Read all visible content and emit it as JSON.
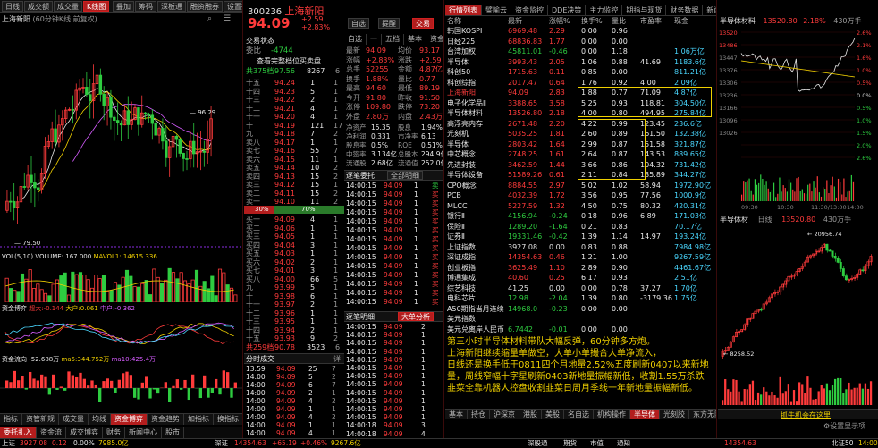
{
  "colors": {
    "up": "#ff3b3b",
    "down": "#2ecc40",
    "accent": "#f0d000",
    "cyan": "#4ad7ff",
    "purple": "#d65cff",
    "bg": "#000000"
  },
  "left": {
    "toolbar": [
      "日线",
      "成交额",
      "成交量",
      "K线图",
      "叠加",
      "筹码",
      "深板通",
      "融资融券",
      "设置指标"
    ],
    "header": {
      "name": "上海新阳",
      "suffix": "(60分钟K线 前复权)"
    },
    "icons": [
      "search-icon",
      "list-icon"
    ],
    "price_labels": {
      "high": "96.29",
      "low": "79.50"
    },
    "vol_header": {
      "name": "VOL(5,10)",
      "vol": "VOLUME: 167.000",
      "ma5": "MAVOL1: 14615.336",
      "buttons": [
        "加指标",
        "加指标",
        "换指标"
      ]
    },
    "fund_header": {
      "name": "资金博弈",
      "big": "超大:-0.144",
      "mid": "大户:0.061",
      "small": "中户:-0.362",
      "retail": "散户数据",
      "buttons": [
        "加指标",
        "换指标"
      ]
    },
    "flow_header": {
      "name": "资金流向",
      "amt": "-52.688万",
      "ma5": "ma5:344.752万",
      "ma10": "ma10:425.4万",
      "buttons": [
        "加指标",
        "换指标"
      ]
    },
    "bottom_tabs": [
      "指标",
      "资管新规",
      "成交量",
      "均线",
      "资金博弈",
      "资金趋势",
      "加指标",
      "换指标"
    ],
    "footer": [
      "委托扎入",
      "资金流",
      "成交博弈",
      "财务",
      "新闻中心",
      "股市"
    ]
  },
  "middle": {
    "code": "300236",
    "name": "上海新阳",
    "price": "94.09",
    "change": "+2.59",
    "pct": "+2.83%",
    "buttons": {
      "self": "自选",
      "alert": "提醒",
      "trade": "交易",
      "quick": "快捷"
    },
    "tabs": [
      "自选",
      "一",
      "五档",
      "基本",
      "资金",
      "明细"
    ],
    "stats_title": "交易状态",
    "stat1": [
      {
        "k": "委比",
        "v": "-40.24%",
        "k2": "委差",
        "v2": "-4744"
      }
    ],
    "orderbook_link": "查看完整档位买卖盘",
    "total_ask": {
      "label": "共375档",
      "price": "97.56",
      "vol": "8267",
      "n": "6"
    },
    "asks": [
      {
        "l": "十五",
        "p": "94.24",
        "v": "1",
        "n": "1"
      },
      {
        "l": "十四",
        "p": "94.23",
        "v": "5",
        "n": "1"
      },
      {
        "l": "十三",
        "p": "94.22",
        "v": "2",
        "n": "1"
      },
      {
        "l": "十二",
        "p": "94.21",
        "v": "4",
        "n": "1"
      },
      {
        "l": "十一",
        "p": "94.20",
        "v": "4",
        "n": "1"
      },
      {
        "l": "十",
        "p": "94.19",
        "v": "121",
        "n": "17"
      },
      {
        "l": "九",
        "p": "94.18",
        "v": "7",
        "n": "2"
      },
      {
        "l": "卖八",
        "p": "94.17",
        "v": "1",
        "n": "1"
      },
      {
        "l": "卖七",
        "p": "94.16",
        "v": "55",
        "n": "7"
      },
      {
        "l": "卖六",
        "p": "94.15",
        "v": "11",
        "n": "1"
      },
      {
        "l": "卖五",
        "p": "94.14",
        "v": "10",
        "n": "2"
      },
      {
        "l": "卖四",
        "p": "94.13",
        "v": "15",
        "n": "2"
      },
      {
        "l": "卖三",
        "p": "94.12",
        "v": "15",
        "n": "1"
      },
      {
        "l": "卖二",
        "p": "94.11",
        "v": "15",
        "n": "2"
      },
      {
        "l": "卖一",
        "p": "94.10",
        "v": "11",
        "n": "2"
      }
    ],
    "ratio": {
      "buy": "30%",
      "sell": "70%"
    },
    "bids": [
      {
        "l": "买一",
        "p": "94.09",
        "v": "4",
        "n": "1"
      },
      {
        "l": "买二",
        "p": "94.06",
        "v": "1",
        "n": "1"
      },
      {
        "l": "买三",
        "p": "94.05",
        "v": "1",
        "n": "1"
      },
      {
        "l": "买四",
        "p": "94.04",
        "v": "3",
        "n": "1"
      },
      {
        "l": "买五",
        "p": "94.03",
        "v": "1",
        "n": "1"
      },
      {
        "l": "买六",
        "p": "94.02",
        "v": "2",
        "n": "1"
      },
      {
        "l": "买七",
        "p": "94.01",
        "v": "3",
        "n": "1"
      },
      {
        "l": "买八",
        "p": "94.00",
        "v": "66",
        "n": "5"
      },
      {
        "l": "九",
        "p": "93.99",
        "v": "5",
        "n": "1"
      },
      {
        "l": "十",
        "p": "93.98",
        "v": "6",
        "n": "1"
      },
      {
        "l": "十一",
        "p": "93.97",
        "v": "2",
        "n": "1"
      },
      {
        "l": "十二",
        "p": "93.96",
        "v": "1",
        "n": "1"
      },
      {
        "l": "十三",
        "p": "93.95",
        "v": "1",
        "n": "1"
      },
      {
        "l": "十四",
        "p": "93.94",
        "v": "2",
        "n": "1"
      },
      {
        "l": "十五",
        "p": "93.93",
        "v": "9",
        "n": "2"
      }
    ],
    "total_bid": {
      "label": "共259档",
      "price": "90.78",
      "vol": "3523",
      "n": "6"
    },
    "quote": [
      [
        "最新",
        "94.09",
        "均价",
        "93.17"
      ],
      [
        "涨幅",
        "+2.83%",
        "涨跌",
        "+2.59"
      ],
      [
        "总手",
        "52255",
        "金额",
        "4.87亿"
      ],
      [
        "换手",
        "1.88%",
        "量比",
        "0.77"
      ],
      [
        "最高",
        "94.60",
        "最低",
        "89.19"
      ],
      [
        "今开",
        "91.80",
        "昨收",
        "91.50"
      ],
      [
        "涨停",
        "109.80",
        "跌停",
        "73.20"
      ],
      [
        "外盘",
        "2.80万",
        "内盘",
        "2.43万"
      ]
    ],
    "fundamentals": [
      [
        "净资产",
        "15.35",
        "股息",
        "1.94%"
      ],
      [
        "净利润",
        "0.331",
        "市净率",
        "6.13"
      ],
      [
        "股息率",
        "0.5%",
        "ROE",
        "0.51%"
      ],
      [
        "中签率",
        "3.134亿",
        "总股本",
        "294.9亿"
      ],
      [
        "流通股",
        "2.68亿",
        "流通值",
        "252.0亿"
      ]
    ],
    "ticks_header": {
      "title": "逐笔委托",
      "filter": "全部明细"
    },
    "ticks": [
      [
        "14:00:15",
        "94.09",
        "1",
        "卖"
      ],
      [
        "14:00:15",
        "94.09",
        "1",
        "买"
      ],
      [
        "14:00:15",
        "94.09",
        "1",
        "买"
      ],
      [
        "14:00:15",
        "94.09",
        "1",
        "买"
      ],
      [
        "14:00:15",
        "94.09",
        "1",
        "买"
      ],
      [
        "14:00:15",
        "94.09",
        "1",
        "买"
      ],
      [
        "14:00:15",
        "94.09",
        "1",
        "买"
      ],
      [
        "14:00:15",
        "94.09",
        "1",
        "买"
      ],
      [
        "14:00:15",
        "94.09",
        "1",
        "买"
      ],
      [
        "14:00:15",
        "94.09",
        "1",
        "买"
      ],
      [
        "14:00:15",
        "94.09",
        "1",
        "买"
      ],
      [
        "14:00:15",
        "94.09",
        "1",
        "买"
      ],
      [
        "14:00:15",
        "94.09",
        "1",
        "买"
      ],
      [
        "14:00:15",
        "94.09",
        "1",
        "买"
      ],
      [
        "14:00:15",
        "94.09",
        "1",
        "买"
      ],
      [
        "14:00:18",
        "94.09",
        "1",
        "买"
      ],
      [
        "14:00:18",
        "94.09",
        "1",
        "买"
      ],
      [
        "14:00:18",
        "94.09",
        "1",
        "买"
      ],
      [
        "14:00:18",
        "94.09",
        "1",
        "买"
      ],
      [
        "14:00:18",
        "94.09",
        "1",
        "买"
      ]
    ],
    "fill_header": {
      "title": "逐笔明细",
      "filter": "大单分析"
    },
    "fills": [
      [
        "14:00:15",
        "94.09",
        "2"
      ],
      [
        "14:00:15",
        "94.09",
        "1"
      ],
      [
        "14:00:15",
        "94.09",
        "1"
      ],
      [
        "14:00:15",
        "94.09",
        "1"
      ],
      [
        "14:00:15",
        "94.09",
        "1"
      ],
      [
        "14:00:15",
        "94.09",
        "1"
      ],
      [
        "14:00:15",
        "94.09",
        "1"
      ],
      [
        "14:00:15",
        "94.09",
        "1"
      ],
      [
        "14:00:15",
        "94.09",
        "1"
      ],
      [
        "14:00:15",
        "94.09",
        "1"
      ],
      [
        "14:00:15",
        "94.09",
        "1"
      ],
      [
        "14:00:15",
        "94.09",
        "1"
      ],
      [
        "14:00:18",
        "94.09",
        "3"
      ],
      [
        "14:00:18",
        "94.09",
        "4"
      ]
    ],
    "minute_header": {
      "title": "分时成交",
      "expand": "详"
    },
    "minutes": [
      [
        "13:59",
        "94.09",
        "25",
        "7"
      ],
      [
        "14:00",
        "94.09",
        "5",
        "2"
      ],
      [
        "14:00",
        "94.09",
        "6",
        "7"
      ],
      [
        "14:00",
        "94.09",
        "2",
        "1"
      ],
      [
        "14:00",
        "94.09",
        "4",
        "2"
      ],
      [
        "14:00",
        "94.09",
        "1",
        "1"
      ],
      [
        "14:00",
        "94.09",
        "4",
        "2"
      ],
      [
        "14:00",
        "94.09",
        "1",
        "1"
      ],
      [
        "14:00",
        "94.09",
        "4",
        "1"
      ]
    ]
  },
  "table": {
    "tabs": [
      "行情列表",
      "譬喻云",
      "资金监控",
      "DDE决策",
      "主力监控",
      "期指与现货",
      "财务数据",
      "新闻资讯",
      "多窗同列"
    ],
    "headers": [
      "名称",
      "最新",
      "涨幅%",
      "换手%",
      "量比",
      "市盈率",
      "现金"
    ],
    "rows": [
      [
        "韩国KOSPI",
        "6969.48",
        "2.29",
        "0.00",
        "0.96",
        "",
        ""
      ],
      [
        "日经225",
        "68836.83",
        "1.77",
        "0.00",
        "0.00",
        "",
        ""
      ],
      [
        "台湾加权",
        "45811.01",
        "-0.46",
        "0.00",
        "1.18",
        "",
        "1.06万亿"
      ],
      [
        "半导体",
        "3993.43",
        "2.05",
        "1.06",
        "0.88",
        "41.69",
        "1183.6亿"
      ],
      [
        "科创50",
        "1715.63",
        "0.11",
        "0.85",
        "0.00",
        "",
        "811.21亿"
      ],
      [
        "科创综指",
        "2017.47",
        "0.64",
        "1.76",
        "0.92",
        "4.00",
        "2.09亿"
      ],
      [
        "上海新阳",
        "94.09",
        "2.83",
        "1.88",
        "0.77",
        "71.09",
        "4.87亿"
      ],
      [
        "电子化学品Ⅱ",
        "3388.65",
        "3.58",
        "5.25",
        "0.93",
        "118.81",
        "304.50亿"
      ],
      [
        "半导体材料",
        "13526.80",
        "2.18",
        "4.00",
        "0.80",
        "494.95",
        "275.84亿"
      ],
      [
        "高浮亮内存",
        "2671.48",
        "2.20",
        "4.22",
        "0.99",
        "123.45",
        "236.6亿"
      ],
      [
        "光刻机",
        "5035.25",
        "1.81",
        "2.60",
        "0.89",
        "161.50",
        "132.38亿"
      ],
      [
        "半导体",
        "2803.42",
        "1.64",
        "2.99",
        "0.87",
        "151.58",
        "321.87亿"
      ],
      [
        "中芯概念",
        "2748.25",
        "1.61",
        "2.64",
        "0.87",
        "143.53",
        "889.65亿"
      ],
      [
        "先进封装",
        "3462.59",
        "1.44",
        "3.66",
        "0.86",
        "104.32",
        "731.42亿"
      ],
      [
        "半导体设备",
        "51589.26",
        "0.61",
        "2.11",
        "0.84",
        "135.89",
        "344.27亿"
      ],
      [
        "CPO概念",
        "8884.55",
        "2.97",
        "5.02",
        "1.02",
        "58.94",
        "1972.90亿"
      ],
      [
        "PCB",
        "4032.39",
        "1.72",
        "3.56",
        "0.95",
        "77.56",
        "1000.9亿"
      ],
      [
        "MLCC",
        "5227.59",
        "1.32",
        "4.50",
        "0.75",
        "80.32",
        "420.31亿"
      ],
      [
        "银行Ⅱ",
        "4156.94",
        "-0.24",
        "0.18",
        "0.96",
        "6.89",
        "171.03亿"
      ],
      [
        "保险Ⅱ",
        "1289.20",
        "-1.64",
        "0.21",
        "0.83",
        "",
        "70.17亿"
      ],
      [
        "证券Ⅱ",
        "19331.46",
        "-0.42",
        "1.39",
        "1.14",
        "14.97",
        "193.24亿"
      ],
      [
        "上证指数",
        "3927.08",
        "0.00",
        "0.83",
        "0.88",
        "",
        "7984.98亿"
      ],
      [
        "深证成指",
        "14354.63",
        "0.46",
        "1.21",
        "1.00",
        "",
        "9267.59亿"
      ],
      [
        "创业板指",
        "3625.49",
        "1.10",
        "2.89",
        "0.90",
        "",
        "4461.67亿"
      ],
      [
        "博通集成",
        "40.60",
        "0.25",
        "6.17",
        "0.93",
        "",
        "2.51亿"
      ],
      [
        "综艺科技",
        "41.25",
        "0.00",
        "0.00",
        "0.78",
        "37.27",
        "1.70亿"
      ],
      [
        "电科芯片",
        "12.98",
        "-2.04",
        "1.39",
        "0.80",
        "-3179.36",
        "1.75亿"
      ],
      [
        "A50期指当月连续",
        "14968.0",
        "-0.23",
        "0.00",
        "0.00",
        "",
        ""
      ],
      [
        "美元指数",
        "",
        "",
        "",
        "",
        "",
        ""
      ],
      [
        "美元兑离岸人民币",
        "6.7442",
        "-0.01",
        "0.00",
        "0.00",
        "",
        ""
      ]
    ],
    "news": [
      "第三小时半导体材料带队大幅反弹，60分钟多方炮。",
      "上海新阳继续缩量单做空，大单小单撮合大单净流入，",
      "日线还是换手低于0811四个月地量2.52%五度刷新0407以来新地",
      "量，周线窄幅十字星刷新0403新地量振幅新低，收割1.55万杀跌",
      "韭菜全靠机器人控盘收割韭菜日周月季线一年新地量振幅新低。"
    ],
    "bottom_tabs": [
      "基本",
      "持仓",
      "沪深京",
      "港股",
      "美股",
      "名自选",
      "机构操作",
      "半导体",
      "光刻胶",
      "东方无限量",
      "债券",
      "更多"
    ],
    "bottom_active": "半导体"
  },
  "right": {
    "top": {
      "title": "半导体材料",
      "price": "13520.80",
      "pct": "2.18%",
      "vol": "430万手",
      "y_labels_right": [
        "2.6%",
        "2.1%",
        "1.6%",
        "1.0%",
        "0.5%",
        "0.0%",
        "0.5%",
        "1.0%",
        "1.5%",
        "2.0%",
        "2.6%"
      ],
      "y_labels_left": [
        "13520",
        "13486",
        "13447",
        "13376",
        "13306",
        "13236",
        "13166",
        "13096",
        "13026"
      ],
      "x_labels": [
        "09:30",
        "10:30",
        "11:30/13:00",
        "14:00"
      ]
    },
    "bottom": {
      "title": "半导体材",
      "period": "日线",
      "price": "13520.80",
      "vol": "430万手",
      "high_label": "20956.74",
      "low_label": "8258.52"
    },
    "ticker": "抓牛机会在这里",
    "settings": "设置显示项"
  },
  "footer": {
    "items": [
      {
        "name": "上证",
        "value": "3927.08",
        "chg": "0.12",
        "pct": "0.00%",
        "amt": "7985.0亿"
      },
      {
        "name": "深证",
        "value": "14354.63",
        "chg": "+65.19",
        "pct": "+0.46%",
        "amt": "9267.6亿"
      },
      {
        "name": "北证50",
        "value": "1413",
        "chg": "",
        "pct": "",
        "amt": ""
      }
    ],
    "status": [
      "深股通",
      "期货",
      "市值",
      "通知"
    ],
    "clock": "14:00"
  }
}
